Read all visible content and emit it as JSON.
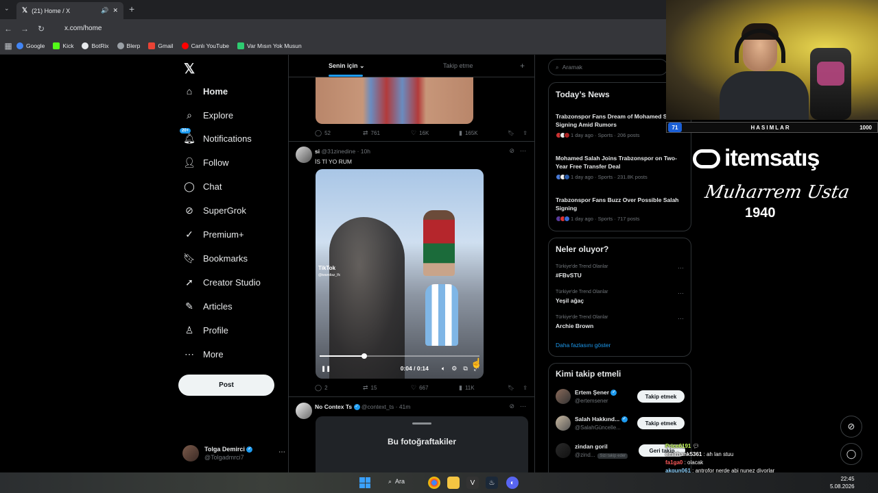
{
  "browser": {
    "tab_title": "(21) Home / X",
    "url": "x.com/home",
    "bookmarks": [
      {
        "label": "Google",
        "color": "#4285f4"
      },
      {
        "label": "Kick",
        "color": "#53fc18"
      },
      {
        "label": "BotRix",
        "color": "#e8eaed"
      },
      {
        "label": "Blerp",
        "color": "#e8eaed"
      },
      {
        "label": "Gmail",
        "color": "#ea4335"
      },
      {
        "label": "Canlı YouTube",
        "color": "#ff0000"
      },
      {
        "label": "Var Mısın Yok Musun",
        "color": "#2ecc71"
      }
    ]
  },
  "nav": {
    "items": [
      {
        "label": "Home",
        "icon": "home-icon"
      },
      {
        "label": "Explore",
        "icon": "search-icon"
      },
      {
        "label": "Notifications",
        "icon": "bell-icon",
        "badge": "20+"
      },
      {
        "label": "Follow",
        "icon": "person-add-icon"
      },
      {
        "label": "Chat",
        "icon": "chat-icon"
      },
      {
        "label": "SuperGrok",
        "icon": "grok-icon"
      },
      {
        "label": "Premium+",
        "icon": "premium-icon"
      },
      {
        "label": "Bookmarks",
        "icon": "bookmark-icon"
      },
      {
        "label": "Creator Studio",
        "icon": "rocket-icon"
      },
      {
        "label": "Articles",
        "icon": "article-icon"
      },
      {
        "label": "Profile",
        "icon": "person-icon"
      },
      {
        "label": "More",
        "icon": "more-icon"
      }
    ],
    "post_label": "Post",
    "account": {
      "name": "Tolga Demirci",
      "handle": "@Tolgadmrci7"
    }
  },
  "timeline": {
    "tab_for_you": "Senin için",
    "tab_following": "Takip etme",
    "tweet1": {
      "replies": "52",
      "reposts": "761",
      "likes": "16K",
      "views": "165K"
    },
    "tweet2": {
      "name": "si",
      "handle": "@31zinedine · 10h",
      "text": "İS Tİ YO RUM",
      "tiktok_label": "TikTok",
      "tiktok_handle": "@iwandiaz_lfc",
      "video_time": "0:04 / 0:14",
      "video_progress": 0.28,
      "replies": "2",
      "reposts": "15",
      "likes": "667",
      "views": "11K"
    },
    "tweet3": {
      "name": "No Contex Ts",
      "handle": "@context_ts · 41m",
      "card_title": "Bu fotoğraftakiler"
    }
  },
  "search": {
    "placeholder": "Aramak"
  },
  "news": {
    "title": "Today’s News",
    "items": [
      {
        "title": "Trabzonspor Fans Dream of Mohamed Salah Signing Amid Rumors",
        "meta": "1 day ago · Sports · 206 posts"
      },
      {
        "title": "Mohamed Salah Joins Trabzonspor on Two-Year Free Transfer Deal",
        "meta": "1 day ago · Sports · 231.8K posts"
      },
      {
        "title": "Trabzonspor Fans Buzz Over Possible Salah Signing",
        "meta": "1 day ago · Sports · 717 posts"
      }
    ]
  },
  "trends": {
    "title": "Neler oluyor?",
    "items": [
      {
        "context": "Türkiye'de Trend Olanlar",
        "name": "#FBvSTU"
      },
      {
        "context": "Türkiye'de Trend Olanlar",
        "name": "Yeşil ağaç"
      },
      {
        "context": "Türkiye'de Trend Olanlar",
        "name": "Archie Brown"
      }
    ],
    "show_more": "Daha fazlasını göster"
  },
  "who_to_follow": {
    "title": "Kimi takip etmeli",
    "items": [
      {
        "name": "Ertem Şener",
        "handle": "@ertemsener",
        "button": "Takip etmek"
      },
      {
        "name": "Salah Hakkınd...",
        "handle": "@SalahGüncelle...",
        "button": "Takip etmek"
      },
      {
        "name": "zindan goril",
        "handle": "@zind...",
        "follows_you": "Sizi takip eder",
        "button": "Geri takip"
      }
    ]
  },
  "overlay": {
    "hasimlar_left": "71",
    "hasimlar_title": "HASIMLAR",
    "hasimlar_right": "1000",
    "brand": "itemsatış",
    "signature": "Muharrem Usta",
    "signature_num": "1940",
    "chat": [
      {
        "user": "Price6191",
        "msg": ""
      },
      {
        "user": "emirhank5361",
        "msg": ": ah lan stuu"
      },
      {
        "user": "fa1ga0",
        "msg": ": olacak"
      },
      {
        "user": "akgun061",
        "msg": ": antrofor nerde abi nunez diyorlar"
      }
    ]
  },
  "taskbar": {
    "search_label": "Ara",
    "time": "22:45",
    "date": "5.08.2026"
  }
}
